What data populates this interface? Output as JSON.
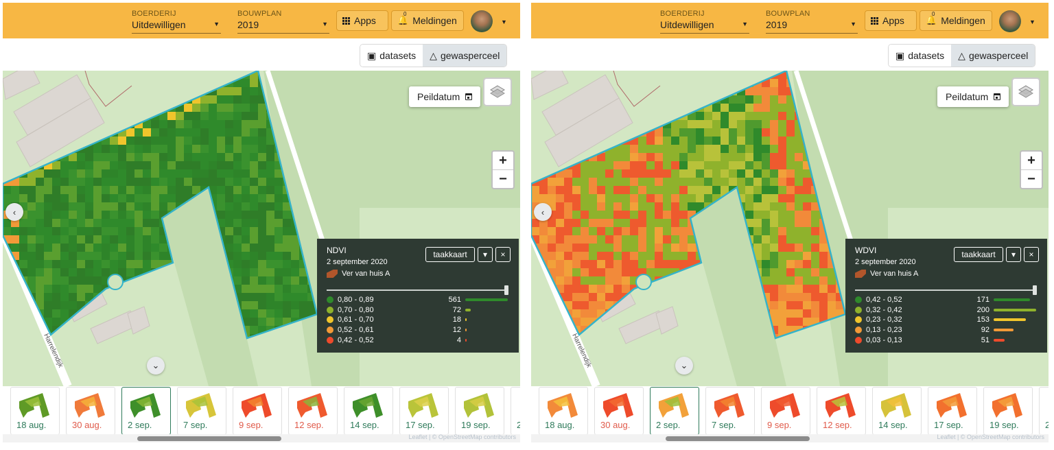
{
  "panels": [
    {
      "header": {
        "farm_label": "BOERDERIJ",
        "farm_value": "Uitdewilligen",
        "plan_label": "BOUWPLAN",
        "plan_value": "2019",
        "apps_label": "Apps",
        "notif_count": "0",
        "notif_label": "Meldingen"
      },
      "segments": [
        "datasets",
        "gewasperceel"
      ],
      "peildatum": "Peildatum",
      "street": "Harrelendijk",
      "legend": {
        "title": "NDVI",
        "date": "2 september 2020",
        "field": "Ver van huis A",
        "button": "taakkaart",
        "rows": [
          {
            "range": "0,80 - 0,89",
            "count": "561",
            "color": "#2f8a2b",
            "share": 1.0
          },
          {
            "range": "0,70 - 0,80",
            "count": "72",
            "color": "#8fb22c",
            "share": 0.128
          },
          {
            "range": "0,61 - 0,70",
            "count": "18",
            "color": "#f0c52c",
            "share": 0.032
          },
          {
            "range": "0,52 - 0,61",
            "count": "12",
            "color": "#f29a38",
            "share": 0.021
          },
          {
            "range": "0,42 - 0,52",
            "count": "4",
            "color": "#ee4b2b",
            "share": 0.007
          }
        ]
      },
      "thumbs": [
        {
          "date": "18 aug.",
          "color": "#2e7a5a",
          "fill": "#5f9a26",
          "fill2": "#9bbf3a"
        },
        {
          "date": "30 aug.",
          "color": "#e05a4a",
          "fill": "#f07a3a",
          "fill2": "#f4b13a"
        },
        {
          "date": "2 sep.",
          "color": "#2e7a5a",
          "fill": "#3e8f2a",
          "fill2": "#86b634"
        },
        {
          "date": "7 sep.",
          "color": "#2e7a5a",
          "fill": "#d7c53a",
          "fill2": "#a8c23a"
        },
        {
          "date": "9 sep.",
          "color": "#e05a4a",
          "fill": "#ee4b2b",
          "fill2": "#f2852e"
        },
        {
          "date": "12 sep.",
          "color": "#e05a4a",
          "fill": "#ef5a2e",
          "fill2": "#8cb43a"
        },
        {
          "date": "14 sep.",
          "color": "#2e7a5a",
          "fill": "#3e8f2a",
          "fill2": "#6aa630"
        },
        {
          "date": "17 sep.",
          "color": "#2e7a5a",
          "fill": "#b9c43a",
          "fill2": "#dcd04a"
        },
        {
          "date": "19 sep.",
          "color": "#2e7a5a",
          "fill": "#b2c23a",
          "fill2": "#d6cc44"
        },
        {
          "date": "2",
          "color": "#2e7a5a",
          "fill": "#ffffff",
          "fill2": "#ffffff"
        }
      ],
      "attribution": "Leaflet | © OpenStreetMap contributors"
    },
    {
      "header": {
        "farm_label": "BOERDERIJ",
        "farm_value": "Uitdewilligen",
        "plan_label": "BOUWPLAN",
        "plan_value": "2019",
        "apps_label": "Apps",
        "notif_count": "0",
        "notif_label": "Meldingen"
      },
      "segments": [
        "datasets",
        "gewasperceel"
      ],
      "peildatum": "Peildatum",
      "street": "Harrelendijk",
      "legend": {
        "title": "WDVI",
        "date": "2 september 2020",
        "field": "Ver van huis A",
        "button": "taakkaart",
        "rows": [
          {
            "range": "0,42 - 0,52",
            "count": "171",
            "color": "#2f8a2b",
            "share": 0.855
          },
          {
            "range": "0,32 - 0,42",
            "count": "200",
            "color": "#8fb22c",
            "share": 1.0
          },
          {
            "range": "0,23 - 0,32",
            "count": "153",
            "color": "#f0c52c",
            "share": 0.765
          },
          {
            "range": "0,13 - 0,23",
            "count": "92",
            "color": "#f29a38",
            "share": 0.46
          },
          {
            "range": "0,03 - 0,13",
            "count": "51",
            "color": "#ee4b2b",
            "share": 0.255
          }
        ]
      },
      "thumbs": [
        {
          "date": "18 aug.",
          "color": "#2e7a5a",
          "fill": "#f28a3a",
          "fill2": "#f4c03a"
        },
        {
          "date": "30 aug.",
          "color": "#e05a4a",
          "fill": "#ee4b2b",
          "fill2": "#f26a30"
        },
        {
          "date": "2 sep.",
          "color": "#2e7a5a",
          "fill": "#f2a13a",
          "fill2": "#9cbf3a"
        },
        {
          "date": "7 sep.",
          "color": "#2e7a5a",
          "fill": "#ef5a2e",
          "fill2": "#f2852e"
        },
        {
          "date": "9 sep.",
          "color": "#e05a4a",
          "fill": "#ee4b2b",
          "fill2": "#f05a30"
        },
        {
          "date": "12 sep.",
          "color": "#e05a4a",
          "fill": "#ee4b2b",
          "fill2": "#b8c23a"
        },
        {
          "date": "14 sep.",
          "color": "#2e7a5a",
          "fill": "#d6c23a",
          "fill2": "#f2c03a"
        },
        {
          "date": "17 sep.",
          "color": "#2e7a5a",
          "fill": "#f2702e",
          "fill2": "#f29a38"
        },
        {
          "date": "19 sep.",
          "color": "#2e7a5a",
          "fill": "#f2702e",
          "fill2": "#f4a03a"
        },
        {
          "date": "2",
          "color": "#2e7a5a",
          "fill": "#ffffff",
          "fill2": "#ffffff"
        }
      ],
      "attribution": "Leaflet | © OpenStreetMap contributors"
    }
  ]
}
